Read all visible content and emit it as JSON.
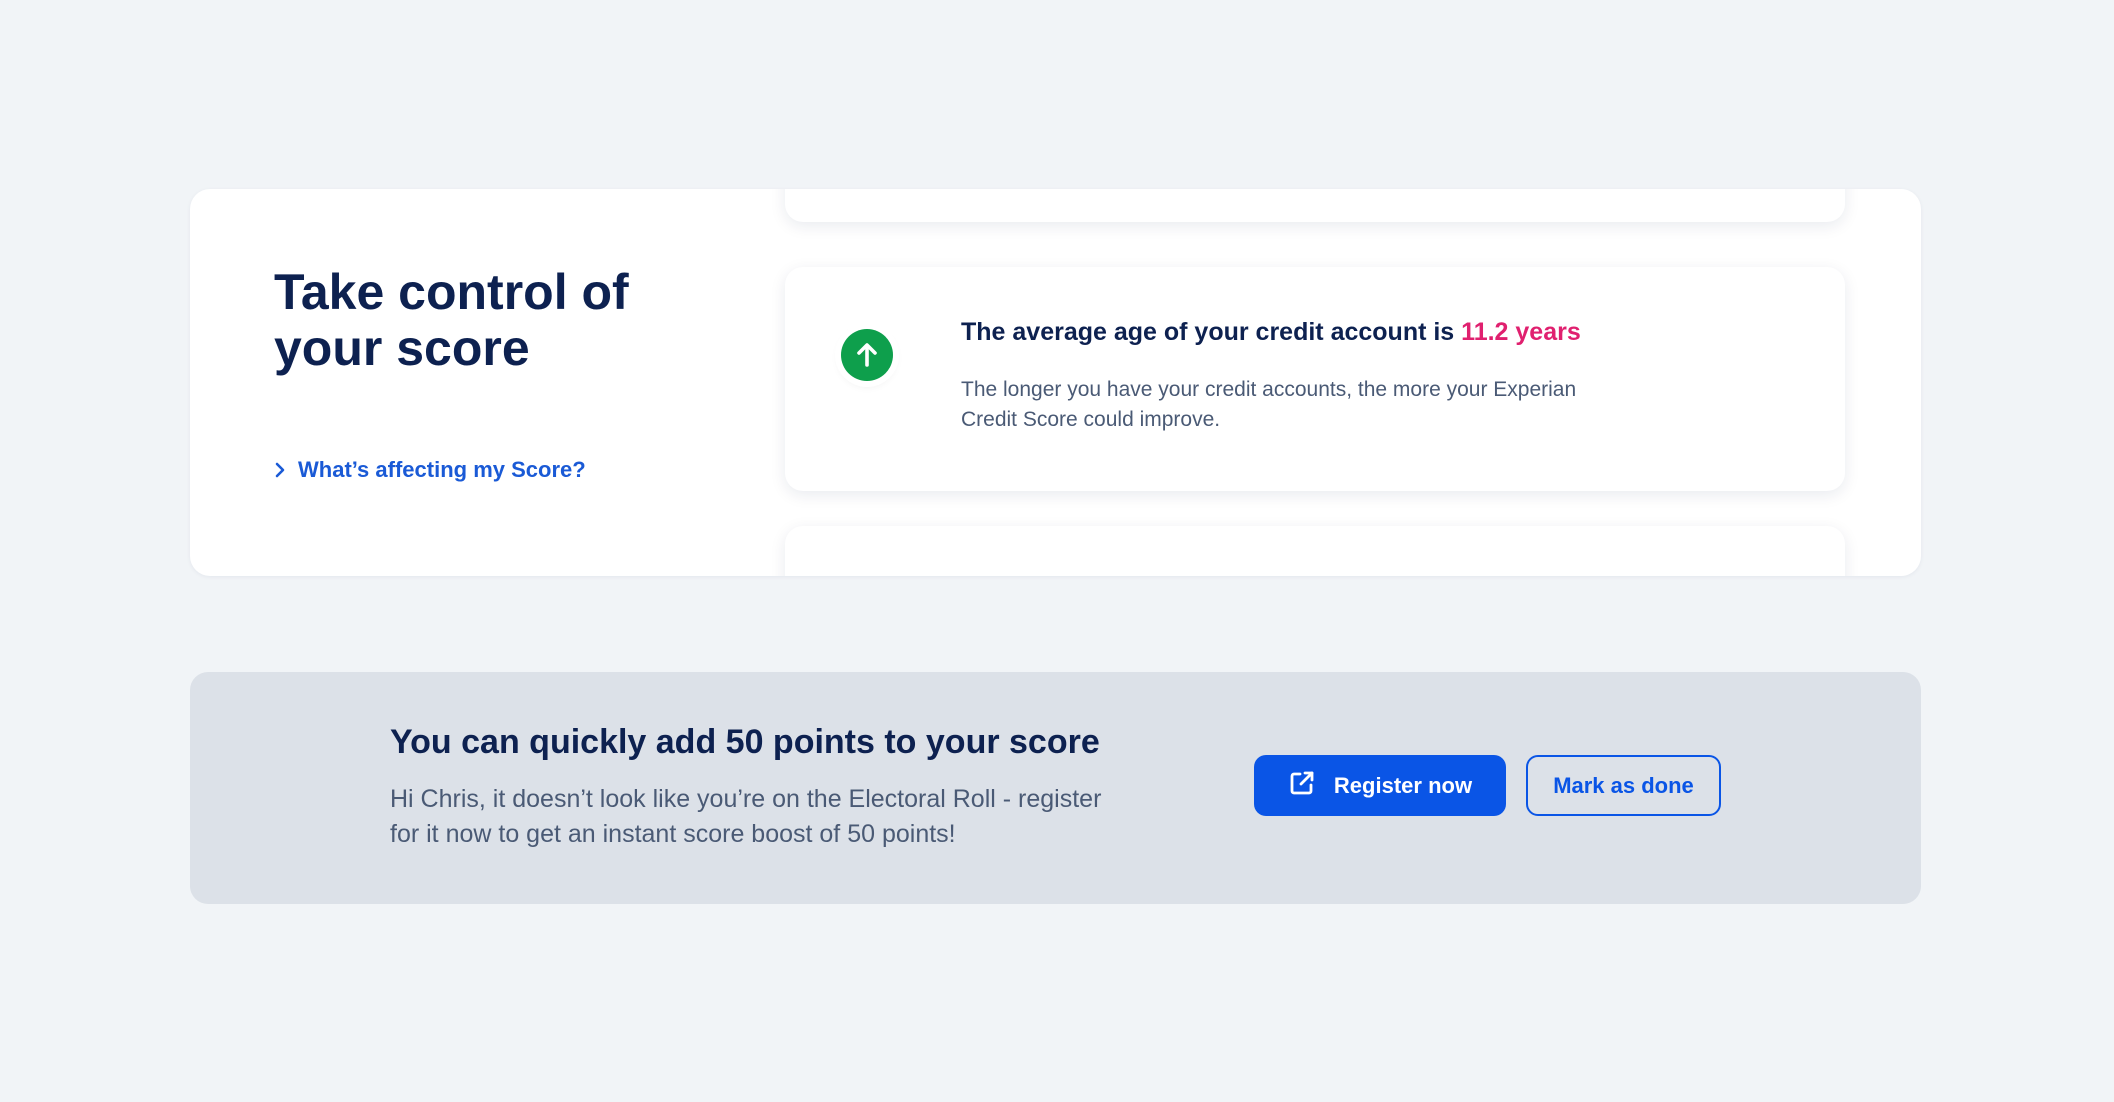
{
  "score_card": {
    "title": "Take control of your score",
    "link_label": "What’s affecting my Score?"
  },
  "factor": {
    "icon": "arrow-up-icon",
    "icon_color": "#0e9f4c",
    "heading_prefix": "The average age of your credit account is",
    "heading_value": "11.2 years",
    "highlight_color": "#e0206f",
    "description": "The longer you have your credit accounts, the more your Experian Credit Score could improve."
  },
  "banner": {
    "title": "You can quickly add 50 points to your score",
    "description": "Hi Chris, it doesn’t look like you’re on the Electoral Roll - register for it now to get an instant score boost of 50 points!",
    "primary_button": "Register now",
    "primary_icon": "external-link-icon",
    "secondary_button": "Mark as done"
  },
  "colors": {
    "background": "#f1f4f7",
    "navy": "#0d2150",
    "accent_blue": "#0a55e6"
  }
}
